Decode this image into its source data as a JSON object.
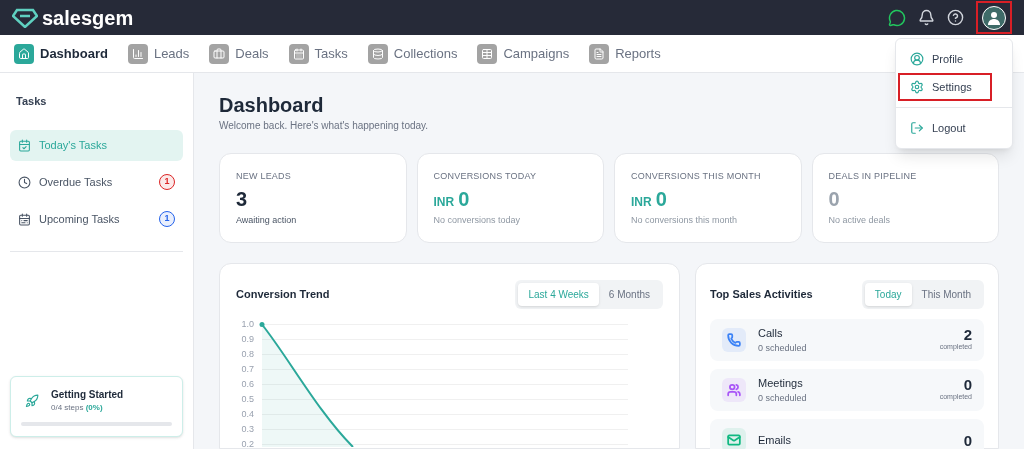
{
  "brand": {
    "name": "salesgem"
  },
  "header_icons": {
    "avatar_highlighted": true
  },
  "nav": [
    {
      "label": "Dashboard",
      "selected": true,
      "kind": "home"
    },
    {
      "label": "Leads",
      "selected": false,
      "kind": "chart"
    },
    {
      "label": "Deals",
      "selected": false,
      "kind": "briefcase"
    },
    {
      "label": "Tasks",
      "selected": false,
      "kind": "calendar"
    },
    {
      "label": "Collections",
      "selected": false,
      "kind": "database"
    },
    {
      "label": "Campaigns",
      "selected": false,
      "kind": "table"
    },
    {
      "label": "Reports",
      "selected": false,
      "kind": "file"
    }
  ],
  "user_menu": [
    {
      "label": "Profile",
      "kind": "user",
      "highlighted": false
    },
    {
      "label": "Settings",
      "kind": "gear",
      "highlighted": true
    },
    {
      "label": "Logout",
      "kind": "logout",
      "highlighted": false
    }
  ],
  "sidebar": {
    "title": "Tasks",
    "items": [
      {
        "label": "Today's Tasks",
        "selected": true,
        "kind": "today"
      },
      {
        "label": "Overdue Tasks",
        "selected": false,
        "kind": "clock",
        "badge": "1",
        "color": "#dc2626"
      },
      {
        "label": "Upcoming Tasks",
        "selected": false,
        "kind": "upcoming",
        "badge": "1",
        "color": "#2563eb"
      }
    ],
    "getting_started": {
      "title": "Getting Started",
      "steps": "0/4 steps",
      "percent": "(0%)",
      "level": 0
    }
  },
  "page": {
    "title": "Dashboard",
    "subtitle": "Welcome back. Here's what's happening today."
  },
  "stats": [
    {
      "label": "NEW LEADS",
      "value": "3",
      "note": "Awaiting action",
      "active": true
    },
    {
      "label": "CONVERSIONS TODAY",
      "prefix": "INR",
      "value": "0",
      "note": "No conversions today",
      "active": true
    },
    {
      "label": "CONVERSIONS THIS MONTH",
      "prefix": "INR",
      "value": "0",
      "note": "No conversions this month",
      "active": true
    },
    {
      "label": "DEALS IN PIPELINE",
      "value": "0",
      "note": "No active deals",
      "active": false
    }
  ],
  "trend": {
    "title": "Conversion Trend",
    "tabs": [
      {
        "label": "Last 4 Weeks",
        "selected": true
      },
      {
        "label": "6 Months",
        "selected": false
      }
    ],
    "y_tick_labels": [
      "1.0",
      "0.9",
      "0.8",
      "0.7",
      "0.6",
      "0.5",
      "0.4",
      "0.3",
      "0.2"
    ]
  },
  "activities": {
    "title": "Top Sales Activities",
    "tabs": [
      {
        "label": "Today",
        "selected": true
      },
      {
        "label": "This Month",
        "selected": false
      }
    ],
    "items": [
      {
        "name": "Calls",
        "scheduled": "0 scheduled",
        "count": "2",
        "count_label": "completed",
        "kind": "phone",
        "color": "#3b82f6"
      },
      {
        "name": "Meetings",
        "scheduled": "0 scheduled",
        "count": "0",
        "count_label": "completed",
        "kind": "users",
        "color": "#a855f7"
      },
      {
        "name": "Emails",
        "count": "0",
        "kind": "mail",
        "color": "#10b981"
      }
    ]
  }
}
